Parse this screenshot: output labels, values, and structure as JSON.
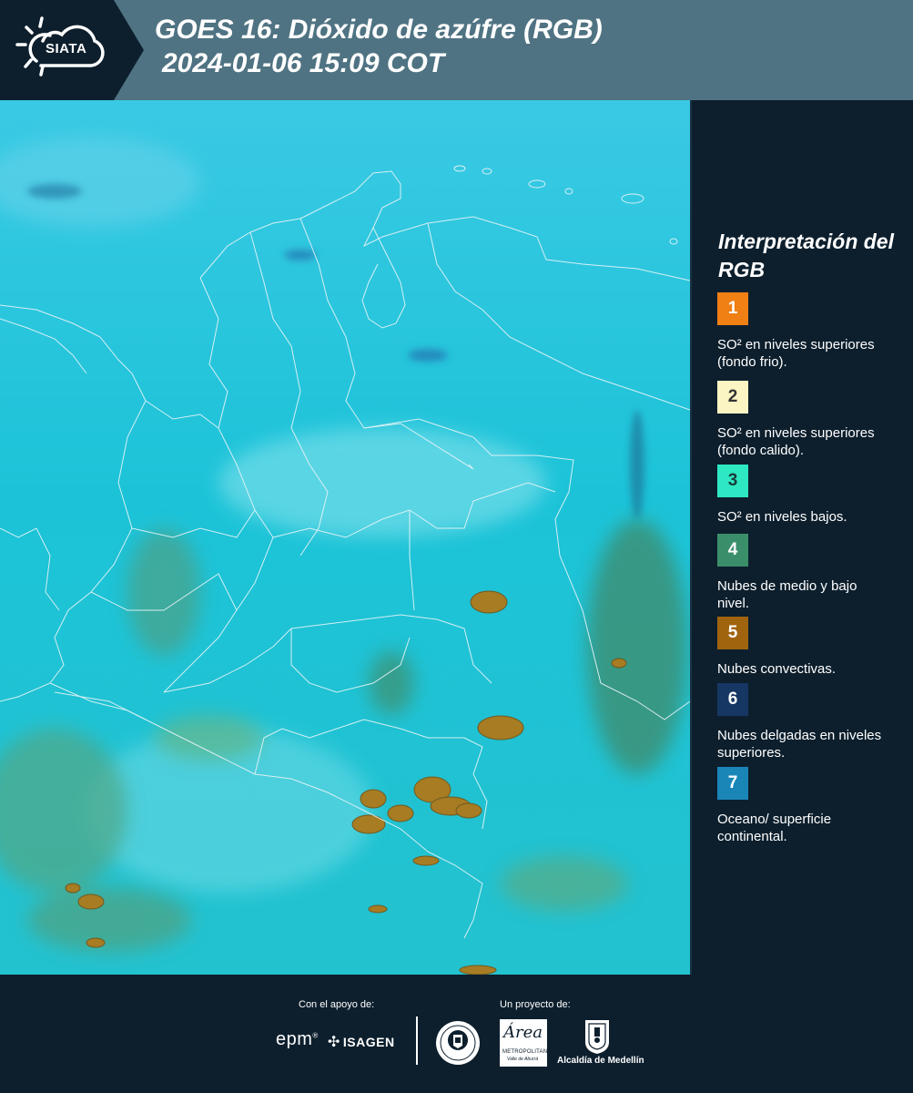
{
  "header": {
    "logo_text": "SIATA",
    "title": "GOES 16: Dióxido de azúfre (RGB)",
    "subtitle": "2024-01-06 15:09 COT",
    "bar_color": "#4f7382",
    "logo_bg_color": "#0d1f2d"
  },
  "map": {
    "description_icon": "satellite-image",
    "background_color": "#1fbfd6",
    "border_line_color": "#e0eef2"
  },
  "legend": {
    "title": "Interpretación del RGB",
    "items": [
      {
        "number": "1",
        "color": "#f07f14",
        "text_color": "#ffffff",
        "label": "SO² en niveles superiores (fondo frio)."
      },
      {
        "number": "2",
        "color": "#fbf5c3",
        "text_color": "#333333",
        "label": "SO² en niveles superiores (fondo calido)."
      },
      {
        "number": "3",
        "color": "#2de8c2",
        "text_color": "#1a3a3a",
        "label": "SO² en niveles bajos."
      },
      {
        "number": "4",
        "color": "#3a8f6a",
        "text_color": "#ffffff",
        "label": "Nubes de medio y bajo nivel."
      },
      {
        "number": "5",
        "color": "#a0640f",
        "text_color": "#ffffff",
        "label": "Nubes convectivas."
      },
      {
        "number": "6",
        "color": "#163764",
        "text_color": "#ffffff",
        "label": "Nubes delgadas en niveles superiores."
      },
      {
        "number": "7",
        "color": "#1a86b8",
        "text_color": "#ffffff",
        "label": "Oceano/ superficie continental."
      }
    ]
  },
  "footer": {
    "support_label": "Con el apoyo de:",
    "project_label": "Un proyecto de:",
    "epm": "epm",
    "isagen": "ISAGEN",
    "area_word": "Área",
    "area_sub": "METROPOLITANA",
    "area_sub2": "Valle de Aburrá",
    "alcaldia": "Alcaldía de Medellín"
  }
}
